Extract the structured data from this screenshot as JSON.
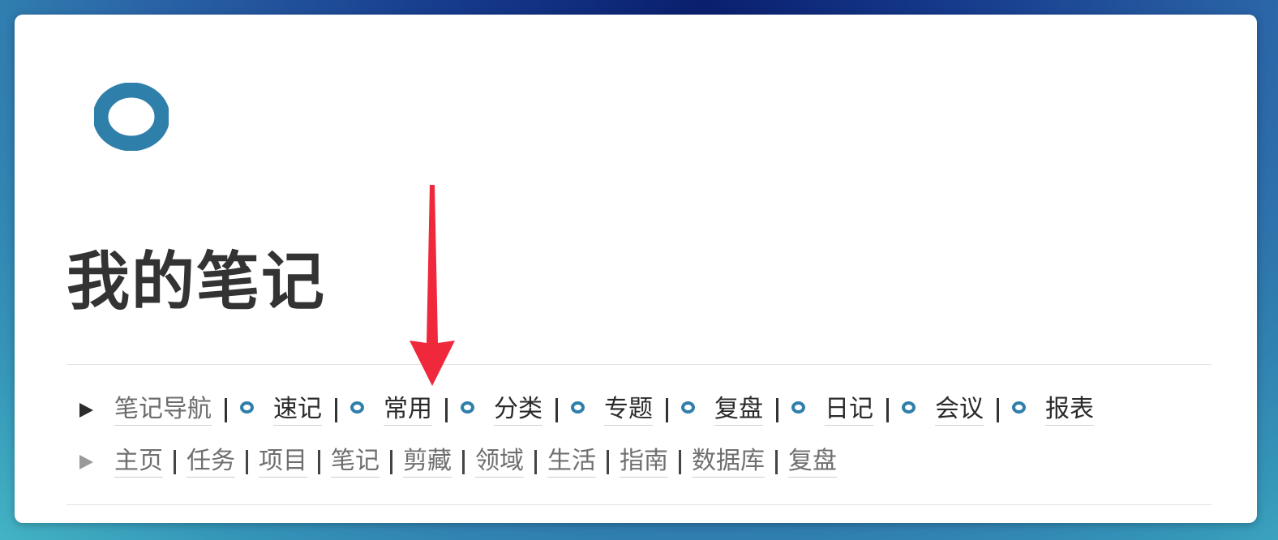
{
  "page": {
    "title": "我的笔记",
    "icon": "blue-ring-icon"
  },
  "nav_primary": {
    "toggle_icon": "triangle-right-icon",
    "home_label": "笔记导航",
    "items": [
      {
        "label": "速记",
        "icon": "blue-ring-icon"
      },
      {
        "label": "常用",
        "icon": "blue-ring-icon"
      },
      {
        "label": "分类",
        "icon": "blue-ring-icon"
      },
      {
        "label": "专题",
        "icon": "blue-ring-icon"
      },
      {
        "label": "复盘",
        "icon": "blue-ring-icon"
      },
      {
        "label": "日记",
        "icon": "blue-ring-icon"
      },
      {
        "label": "会议",
        "icon": "blue-ring-icon"
      },
      {
        "label": "报表",
        "icon": "blue-ring-icon"
      }
    ]
  },
  "nav_secondary": {
    "toggle_icon": "triangle-right-icon",
    "items": [
      {
        "label": "主页"
      },
      {
        "label": "任务"
      },
      {
        "label": "项目"
      },
      {
        "label": "笔记"
      },
      {
        "label": "剪藏"
      },
      {
        "label": "领域"
      },
      {
        "label": "生活"
      },
      {
        "label": "指南"
      },
      {
        "label": "数据库"
      },
      {
        "label": "复盘"
      }
    ]
  },
  "annotation": {
    "icon": "red-arrow-down-icon",
    "color": "#f0283c"
  },
  "colors": {
    "accent": "#2f7fab",
    "title": "#333333"
  }
}
